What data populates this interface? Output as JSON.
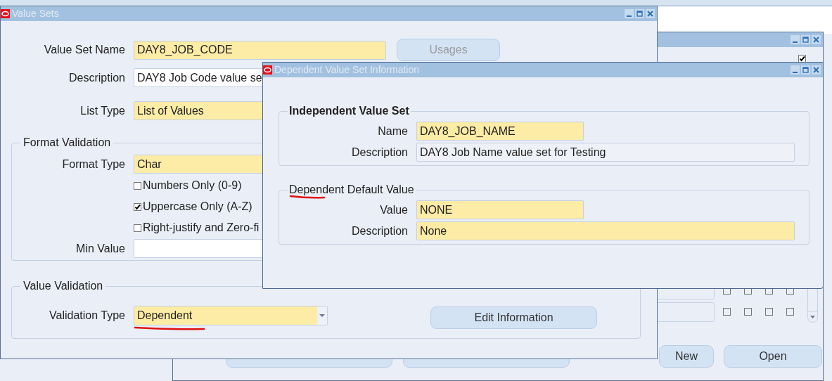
{
  "background_window": {
    "top_checkbox": {
      "checked": true
    },
    "grid_checkboxes": [
      {
        "checked": false
      },
      {
        "checked": false
      },
      {
        "checked": false
      },
      {
        "checked": false
      },
      {
        "checked": false
      },
      {
        "checked": false
      },
      {
        "checked": false
      },
      {
        "checked": false
      }
    ],
    "buttons": [
      "New",
      "Open"
    ]
  },
  "value_sets_window": {
    "title": "Value Sets",
    "fields": [
      {
        "label": "Value Set Name",
        "value": "DAY8_JOB_CODE",
        "required": true
      },
      {
        "label": "Description",
        "value": "DAY8 Job Code value se",
        "required": false
      },
      {
        "label": "List Type",
        "value": "List of Values",
        "required": true
      }
    ],
    "usages_button": {
      "label": "Usages",
      "disabled": true
    },
    "format_validation": {
      "title": "Format Validation",
      "format_type": {
        "label": "Format Type",
        "value": "Char"
      },
      "checkboxes": [
        {
          "label": "Numbers Only (0-9)",
          "checked": false
        },
        {
          "label": "Uppercase Only (A-Z)",
          "checked": true
        },
        {
          "label": "Right-justify and Zero-fi",
          "checked": false
        }
      ],
      "min_value": {
        "label": "Min Value"
      }
    },
    "value_validation": {
      "title": "Value Validation",
      "validation_type": {
        "label": "Validation Type",
        "value": "Dependent"
      },
      "edit_button": "Edit Information"
    }
  },
  "dependent_window": {
    "title": "Dependent Value Set Information",
    "groups": [
      {
        "title": "Independent Value Set",
        "bold": true,
        "fields": [
          {
            "label": "Name",
            "value": "DAY8_JOB_NAME",
            "required": true,
            "wide": false
          },
          {
            "label": "Description",
            "value": "DAY8 Job Name value set for Testing",
            "required": false,
            "wide": true
          }
        ]
      },
      {
        "title": "Dependent Default Value",
        "bold": false,
        "fields": [
          {
            "label": "Value",
            "value": "NONE",
            "required": true,
            "wide": false
          },
          {
            "label": "Description",
            "value": "None",
            "required": true,
            "wide": true
          }
        ]
      }
    ]
  }
}
